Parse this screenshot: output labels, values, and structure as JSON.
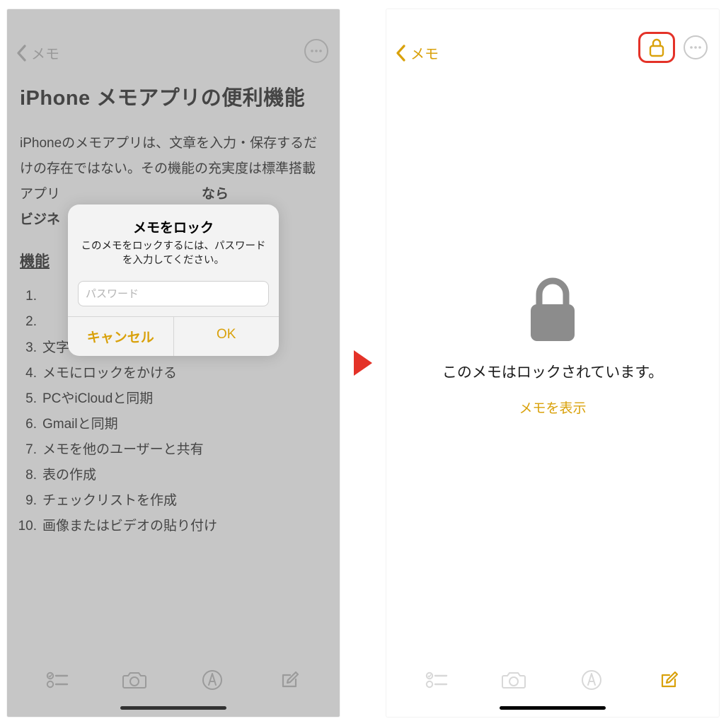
{
  "colors": {
    "accent": "#d9a10b",
    "highlight_border": "#e43228",
    "gray_icon": "#b5b5b5",
    "lock_gray": "#8c8c8c"
  },
  "left": {
    "nav_back_label": "メモ",
    "title": "iPhone メモアプリの便利機能",
    "paragraph_prefix": "iPhoneのメモアプリは、文章を入力・保存するだけの存在ではない。その機能の充実度は標準搭載アプリ",
    "paragraph_suffix_bold_a": "なら",
    "paragraph_suffix_bold_b": "ビジネ",
    "section_heading": "機能",
    "list_items": [
      "",
      "",
      "文字のスタイルを変えてみやすくする",
      "メモにロックをかける",
      "PCやiCloudと同期",
      "Gmailと同期",
      "メモを他のユーザーと共有",
      "表の作成",
      "チェックリストを作成",
      "画像またはビデオの貼り付け"
    ],
    "dialog": {
      "title": "メモをロック",
      "message": "このメモをロックするには、パスワードを入力してください。",
      "placeholder": "パスワード",
      "cancel": "キャンセル",
      "ok": "OK"
    }
  },
  "right": {
    "nav_back_label": "メモ",
    "locked_message": "このメモはロックされています。",
    "show_label": "メモを表示"
  }
}
